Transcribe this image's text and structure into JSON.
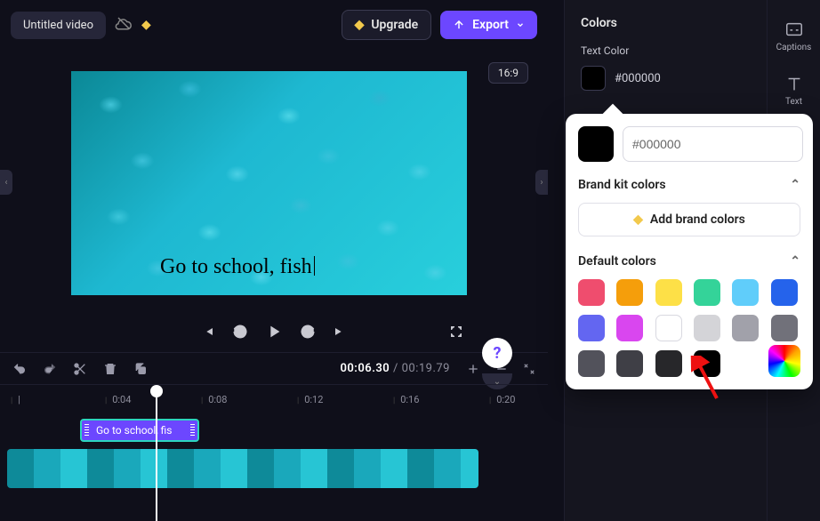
{
  "header": {
    "title": "Untitled video",
    "upgrade": "Upgrade",
    "export": "Export",
    "aspect": "16:9"
  },
  "preview": {
    "overlay_text": "Go to school, fish"
  },
  "time": {
    "current": "00:06",
    "current_frac": ".30",
    "total": "00:19",
    "total_frac": ".79"
  },
  "ruler": [
    "0:04",
    "0:08",
    "0:12",
    "0:16",
    "0:20"
  ],
  "clips": {
    "text_clip_label": "Go to school, fis"
  },
  "panel": {
    "heading": "Colors",
    "text_color_label": "Text Color",
    "text_color_value": "#000000"
  },
  "popover": {
    "hex_value": "#000000",
    "brand_heading": "Brand kit colors",
    "add_brand": "Add brand colors",
    "default_heading": "Default colors",
    "default_colors": [
      "#ef4d6e",
      "#f59e0b",
      "#fde047",
      "#34d399",
      "#60cdfa",
      "#2563eb",
      "#6366f1",
      "#d946ef",
      "#ffffff",
      "#d4d4d8",
      "#a1a1aa",
      "#71717a",
      "#52525b",
      "#3f3f46",
      "#27272a",
      "#000000"
    ]
  },
  "far_right": {
    "captions": "Captions",
    "text": "Text"
  }
}
